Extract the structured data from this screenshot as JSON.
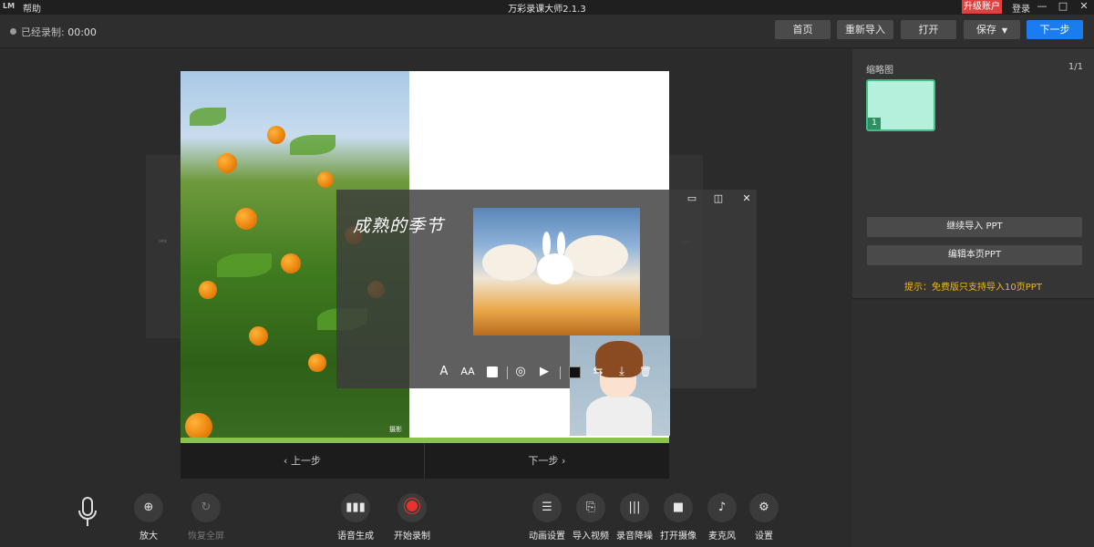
{
  "titlebar": {
    "logo": "LM",
    "help": "帮助",
    "title": "万彩录课大师2.1.3",
    "upgrade": "升级账户",
    "login": "登录",
    "minimize": "—",
    "maximize": "□",
    "close": "✕"
  },
  "toolbar": {
    "recorded_label": "已经录制:",
    "recorded_time": "00:00",
    "buttons": {
      "home": "首页",
      "reimport": "重新导入",
      "open": "打开",
      "save": "保存",
      "next": "下一步"
    }
  },
  "slide": {
    "title": "成熟的季节",
    "photo_credit": "摄影"
  },
  "overlay": {
    "tools": [
      "A",
      "AA",
      "■",
      "◎",
      "▶",
      "■",
      "⇆",
      "⤓",
      "🗑"
    ]
  },
  "nav": {
    "prev": "‹ 上一步",
    "next": "下一步 ›"
  },
  "controls": {
    "zoom_in": "放大",
    "restore": "恢复全屏",
    "tts": "语音生成",
    "start_record": "开始录制",
    "animation": "动画设置",
    "import_video": "导入视频",
    "denoise": "录音降噪",
    "camera": "打开摄像",
    "microphone": "麦克风",
    "settings": "设置"
  },
  "rightpanel": {
    "header": "缩略图",
    "count": "1/1",
    "thumb_number": "1",
    "continue_import": "继续导入 PPT",
    "edit_page": "编辑本页PPT",
    "tip": "提示：免费版只支持导入10页PPT"
  },
  "colors": {
    "accent": "#1a7cf0",
    "upgrade": "#e0413f",
    "tip": "#f3b61b",
    "record": "#e8322a",
    "thumb": "#b4f0dc"
  }
}
